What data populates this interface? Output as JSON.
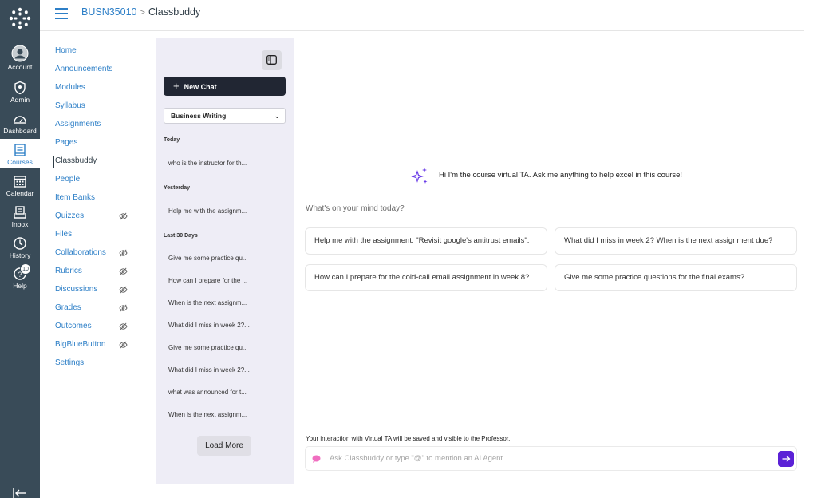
{
  "global_nav": {
    "items": [
      {
        "label": "Account",
        "icon": "account-icon"
      },
      {
        "label": "Admin",
        "icon": "admin-icon"
      },
      {
        "label": "Dashboard",
        "icon": "dashboard-icon"
      },
      {
        "label": "Courses",
        "icon": "courses-icon"
      },
      {
        "label": "Calendar",
        "icon": "calendar-icon"
      },
      {
        "label": "Inbox",
        "icon": "inbox-icon"
      },
      {
        "label": "History",
        "icon": "history-icon"
      },
      {
        "label": "Help",
        "icon": "help-icon",
        "badge": "10"
      }
    ]
  },
  "breadcrumb": {
    "course": "BUSN35010",
    "separator": ">",
    "current": "Classbuddy"
  },
  "course_nav": {
    "items": [
      {
        "label": "Home"
      },
      {
        "label": "Announcements"
      },
      {
        "label": "Modules"
      },
      {
        "label": "Syllabus"
      },
      {
        "label": "Assignments"
      },
      {
        "label": "Pages"
      },
      {
        "label": "Classbuddy",
        "active": true
      },
      {
        "label": "People"
      },
      {
        "label": "Item Banks"
      },
      {
        "label": "Quizzes",
        "hidden_icon": "eye-slash-icon"
      },
      {
        "label": "Files"
      },
      {
        "label": "Collaborations",
        "hidden_icon": "eye-slash-icon"
      },
      {
        "label": "Rubrics",
        "hidden_icon": "eye-slash-icon"
      },
      {
        "label": "Discussions",
        "hidden_icon": "eye-slash-icon"
      },
      {
        "label": "Grades",
        "hidden_icon": "eye-slash-icon"
      },
      {
        "label": "Outcomes",
        "hidden_icon": "eye-slash-icon"
      },
      {
        "label": "BigBlueButton",
        "hidden_icon": "eye-slash-icon"
      },
      {
        "label": "Settings"
      }
    ]
  },
  "history": {
    "new_chat_label": "New Chat",
    "selected_topic": "Business Writing",
    "sections": [
      {
        "title": "Today",
        "items": [
          "who is the instructor for th..."
        ]
      },
      {
        "title": "Yesterday",
        "items": [
          "Help me with the assignm..."
        ]
      },
      {
        "title": "Last 30 Days",
        "items": [
          "Give me some practice qu...",
          "How can I prepare for the ...",
          "When is the next assignm...",
          "What did I miss in week 2?...",
          "Give me some practice qu...",
          "What did I miss in week 2?...",
          "what was announced for t...",
          "When is the next assignm..."
        ]
      }
    ],
    "load_more_label": "Load More"
  },
  "chat": {
    "greeting": "Hi I'm the course virtual TA. Ask me anything to help excel in this course!",
    "prompt_heading": "What's on your mind today?",
    "suggestions": [
      "Help me with the assignment: \"Revisit google's antitrust emails\".",
      "What did I miss in week 2? When is the next assignment due?",
      "How can I prepare for the cold-call email assignment in week 8?",
      "Give me some practice questions for the final exams?"
    ],
    "notice": "Your interaction with Virtual TA will be saved and visible to the Professor.",
    "input_placeholder": "Ask Classbuddy or type \"@\" to mention an AI Agent"
  },
  "colors": {
    "nav_bg": "#394b58",
    "link": "#2d7fc7",
    "send_button": "#5b21d6",
    "new_chat_bg": "#212633",
    "history_bg": "#eeedf6"
  }
}
